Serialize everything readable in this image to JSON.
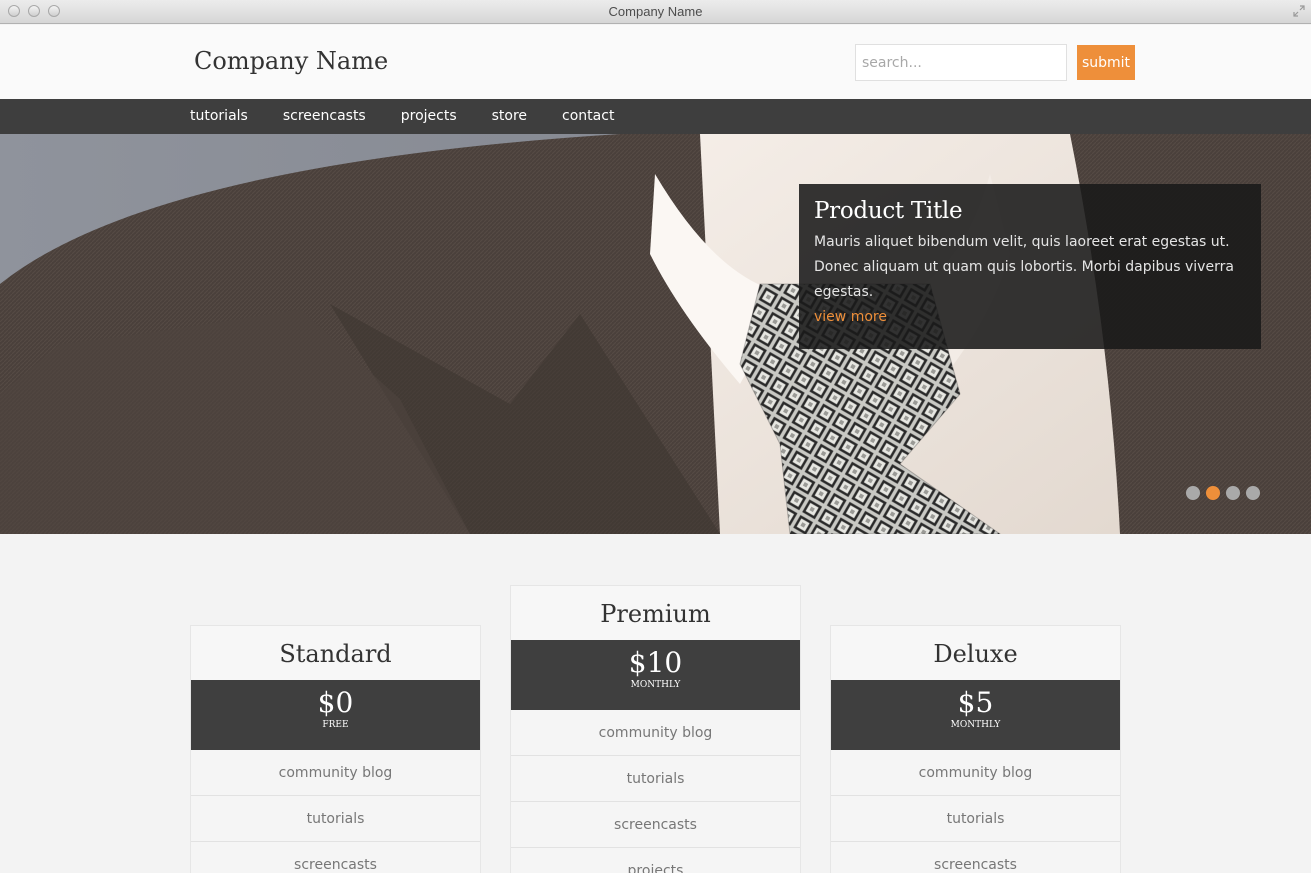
{
  "window": {
    "title": "Company Name"
  },
  "header": {
    "logo": "Company Name",
    "search_placeholder": "search...",
    "submit_label": "submit"
  },
  "nav": {
    "items": [
      "tutorials",
      "screencasts",
      "projects",
      "store",
      "contact"
    ]
  },
  "slider": {
    "title": "Product Title",
    "text": "Mauris aliquet bibendum velit, quis laoreet erat egestas ut. Donec aliquam ut quam quis lobortis. Morbi dapibus viverra egestas.",
    "link": "view more",
    "dot_count": 4,
    "active_dot": 2
  },
  "plans": [
    {
      "name": "Standard",
      "price": "$0",
      "period": "FREE",
      "features": [
        "community blog",
        "tutorials",
        "screencasts"
      ]
    },
    {
      "name": "Premium",
      "price": "$10",
      "period": "MONTHLY",
      "features": [
        "community blog",
        "tutorials",
        "screencasts",
        "projects"
      ]
    },
    {
      "name": "Deluxe",
      "price": "$5",
      "period": "MONTHLY",
      "features": [
        "community blog",
        "tutorials",
        "screencasts"
      ]
    }
  ],
  "colors": {
    "accent": "#ee8f3a",
    "dark": "#3e3e3e"
  }
}
